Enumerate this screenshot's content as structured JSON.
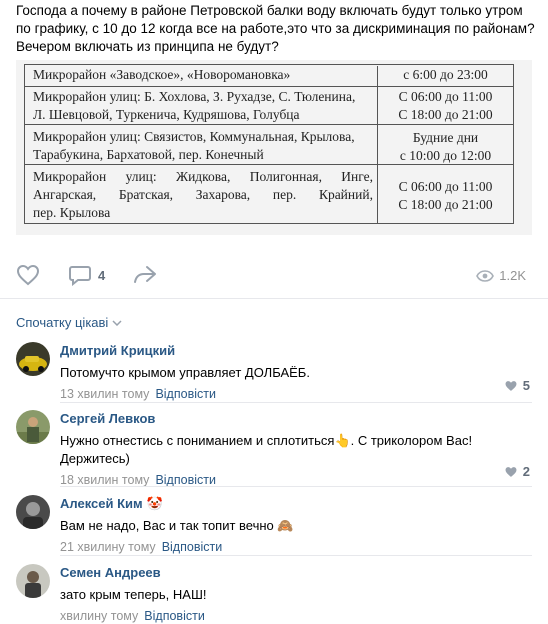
{
  "post": {
    "text_lines": [
      "Господа а почему в районе Петровской балки воду включать будут только утром",
      "по графику, с 10 до 12 когда все на работе,это что за дискриминация по районам?",
      "Вечером включать из принципа не будут?"
    ],
    "schedule": [
      {
        "left": [
          "Микрорайон «Заводское», «Новороманoвка»"
        ],
        "right": [
          "с 6:00 до 23:00"
        ]
      },
      {
        "left": [
          "Микрорайон улиц: Б. Хохлова, З. Рухадзе, С. Тюленина,",
          "Л. Шевцовой, Туркенича, Кудряшова, Голубца"
        ],
        "right": [
          "С 06:00 до 11:00",
          "С 18:00 до 21:00"
        ]
      },
      {
        "left": [
          "Микрорайон улиц: Связистов, Коммунальная, Крылова,",
          "Тарабукина, Бархатовой, пер. Конечный"
        ],
        "right": [
          "Будние дни",
          "с 10:00 до 12:00"
        ]
      },
      {
        "left_justify": [
          "Микрорайон",
          "улиц:",
          "Жидкова,",
          "Полигонная,",
          "Инге,"
        ],
        "left_justify2": [
          "Ангарская,",
          "Братская,",
          "Захарова,",
          "пер.",
          "Крайний,"
        ],
        "left_last": "пер. Крылова",
        "right": [
          "С 06:00 до 11:00",
          "С 18:00 до 21:00"
        ]
      }
    ],
    "comments_count": "4",
    "views": "1.2K"
  },
  "icons": {
    "like": "heart-icon",
    "comment": "comment-icon",
    "share": "share-icon",
    "views": "eye-icon",
    "chevron": "chevron-down-icon"
  },
  "comments_header": {
    "sort_label": "Спочатку цікаві"
  },
  "comments": [
    {
      "author": "Дмитрий Крицкий",
      "text": "Потомучто крымом управляет ДОЛБАЁБ.",
      "time": "13 хвилин тому",
      "reply": "Відповісти",
      "likes": "5"
    },
    {
      "author": "Сергей Левков",
      "text": "Нужно отнестись с пониманием и сплотиться👆. С триколором Вас! Держитесь)",
      "time": "18 хвилин тому",
      "reply": "Відповісти",
      "likes": "2"
    },
    {
      "author": "Алексей Ким",
      "author_emoji": "🤡",
      "text": "Вам не надо, Вас и так топит вечно 🙈",
      "time": "21 хвилину тому",
      "reply": "Відповісти",
      "likes": ""
    },
    {
      "author": "Семен Андреев",
      "text": "зато крым теперь, НАШ!",
      "time": "хвилину тому",
      "reply": "Відповісти",
      "likes": ""
    }
  ],
  "colors": {
    "link": "#2a5885",
    "meta": "#939393",
    "divider": "#e7e8ec"
  }
}
